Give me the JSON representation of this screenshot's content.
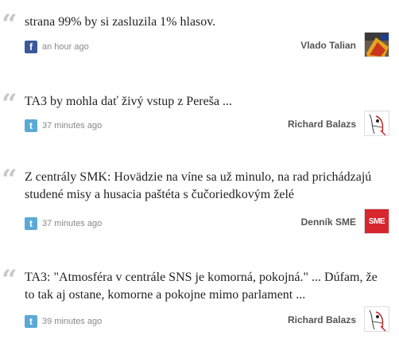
{
  "feed": {
    "items": [
      {
        "text": "strana 99% by si zasluzila 1% hlasov.",
        "source_icon": "facebook-icon",
        "source_glyph": "f",
        "time": "an hour ago",
        "author": "Vlado Talian"
      },
      {
        "text": "TA3 by mohla dať živý vstup z Pereša ...",
        "source_icon": "twitter-icon",
        "source_glyph": "t",
        "time": "37 minutes ago",
        "author": "Richard Balazs"
      },
      {
        "text": "Z centrály SMK: Hovädzie na víne sa už minulo, na rad prichádzajú studené misy a husacia paštéta s čučoriedkovým želé",
        "source_icon": "twitter-icon",
        "source_glyph": "t",
        "time": "37 minutes ago",
        "author": "Denník SME",
        "avatar_text": "SME"
      },
      {
        "text": "TA3: \"Atmosféra v centrále SNS je komorná, pokojná.\" ... Dúfam, že to tak aj ostane, komorne a pokojne mimo parlament ...",
        "source_icon": "twitter-icon",
        "source_glyph": "t",
        "time": "39 minutes ago",
        "author": "Richard Balazs"
      }
    ],
    "colors": {
      "quote_mark": "#c8c8c8",
      "facebook": "#3b5998",
      "twitter": "#5aa9d6",
      "sme_red": "#d8262e"
    }
  }
}
